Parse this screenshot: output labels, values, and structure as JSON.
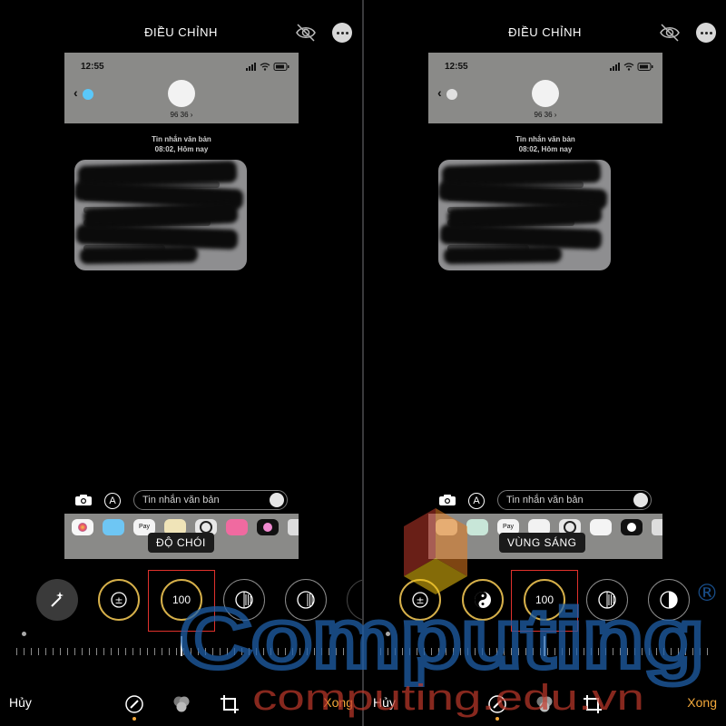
{
  "panels": [
    {
      "title": "ĐIỀU CHỈNH",
      "status_time": "12:55",
      "contact_name": "96 36 ›",
      "message_title": "Tin nhắn văn bản",
      "message_time": "08:02, Hôm nay",
      "input_placeholder": "Tin nhắn văn bản",
      "apple_pay_label": "Pay",
      "adjust_label": "ĐỘ CHÓI",
      "dial_value": "100",
      "cancel": "Hủy",
      "done": "Xong",
      "back_color": "#5ac8fa"
    },
    {
      "title": "ĐIỀU CHỈNH",
      "status_time": "12:55",
      "contact_name": "96 36 ›",
      "message_title": "Tin nhắn văn bản",
      "message_time": "08:02, Hôm nay",
      "input_placeholder": "Tin nhắn văn bản",
      "apple_pay_label": "Pay",
      "adjust_label": "VÙNG SÁNG",
      "dial_value": "100",
      "cancel": "Hủy",
      "done": "Xong",
      "back_color": "#e0e0e0"
    }
  ],
  "watermark": {
    "brand": "Computing",
    "registered": "®",
    "site": "computing.edu.vn"
  },
  "colors": {
    "accent": "#f3a83a",
    "dial_active": "#d6b04a",
    "highlight_box": "#e0312c",
    "watermark_blue": "#1f5fa8",
    "watermark_red": "#c0392b"
  },
  "icons": [
    "eye-slash-icon",
    "more-icon",
    "camera-icon",
    "app-store-icon",
    "magic-wand-icon",
    "exposure-icon",
    "brilliance-icon",
    "highlights-icon",
    "shadows-icon",
    "contrast-icon",
    "adjust-tool-icon",
    "filters-tool-icon",
    "crop-tool-icon"
  ]
}
